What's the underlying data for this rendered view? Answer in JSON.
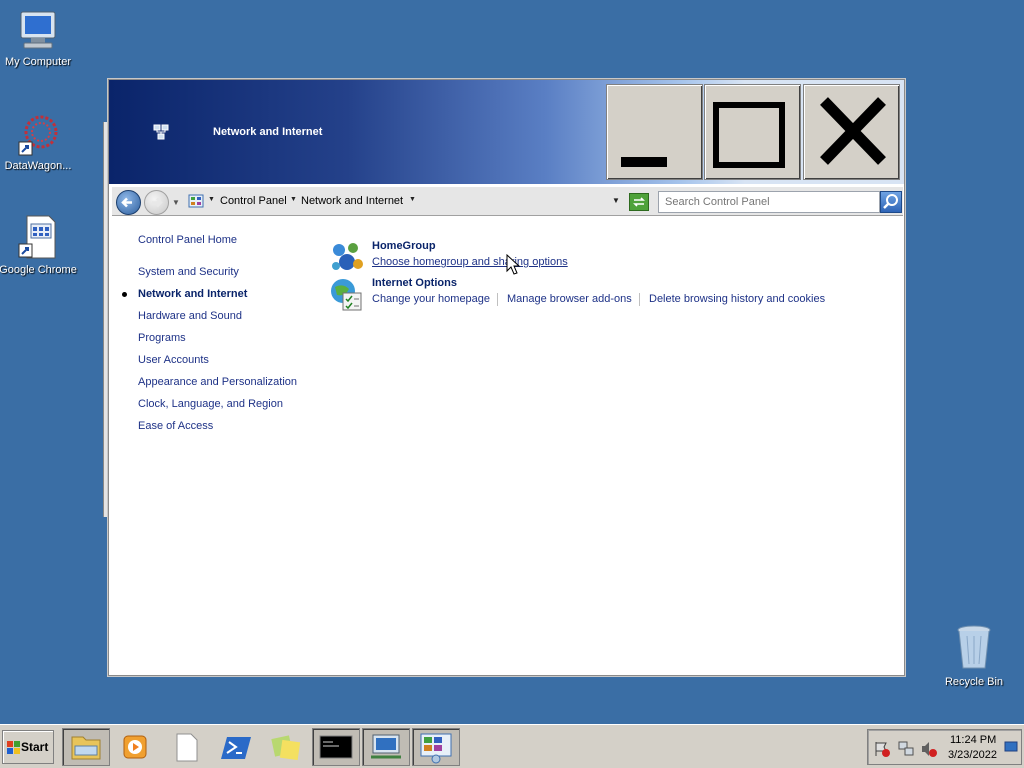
{
  "desktop": {
    "icons": [
      {
        "label": "My Computer",
        "icon": "computer-icon"
      },
      {
        "label": "DataWagon...",
        "icon": "datawagon-icon"
      },
      {
        "label": "Google Chrome",
        "icon": "shortcut-icon"
      },
      {
        "label": "Recycle Bin",
        "icon": "recycle-bin-icon"
      }
    ]
  },
  "window": {
    "title": "Network and Internet",
    "controls": {
      "minimize": "minimize-icon",
      "maximize": "maximize-icon",
      "close": "close-icon"
    },
    "address": {
      "crumbs": [
        "Control Panel",
        "Network and Internet"
      ],
      "search_placeholder": "Search Control Panel"
    },
    "leftnav": {
      "home": "Control Panel Home",
      "items": [
        {
          "label": "System and Security",
          "active": false
        },
        {
          "label": "Network and Internet",
          "active": true
        },
        {
          "label": "Hardware and Sound",
          "active": false
        },
        {
          "label": "Programs",
          "active": false
        },
        {
          "label": "User Accounts",
          "active": false
        },
        {
          "label": "Appearance and Personalization",
          "active": false
        },
        {
          "label": "Clock, Language, and Region",
          "active": false
        },
        {
          "label": "Ease of Access",
          "active": false
        }
      ]
    },
    "categories": [
      {
        "title": "HomeGroup",
        "icon": "homegroup-icon",
        "links": [
          "Choose homegroup and sharing options"
        ]
      },
      {
        "title": "Internet Options",
        "icon": "internet-options-icon",
        "links": [
          "Change your homepage",
          "Manage browser add-ons",
          "Delete browsing history and cookies"
        ]
      }
    ]
  },
  "taskbar": {
    "start_label": "Start",
    "tasks": [
      "file-explorer-icon",
      "media-player-icon",
      "notepad-icon",
      "powershell-icon",
      "sticky-notes-icon",
      "command-prompt-icon",
      "network-connections-icon",
      "control-panel-icon"
    ],
    "clock_time": "11:24 PM",
    "clock_date": "3/23/2022"
  },
  "colors": {
    "desktop": "#3a6ea5",
    "link": "#1e3287",
    "heading": "#0a246a"
  }
}
